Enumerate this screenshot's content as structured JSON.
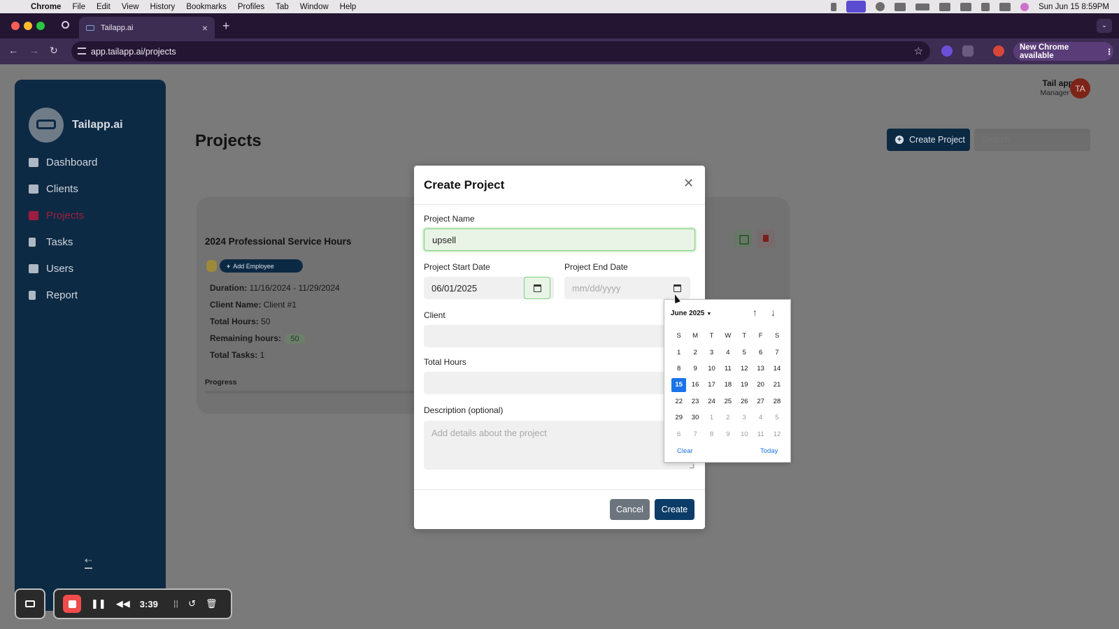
{
  "menubar": {
    "app": "Chrome",
    "items": [
      "File",
      "Edit",
      "View",
      "History",
      "Bookmarks",
      "Profiles",
      "Tab",
      "Window",
      "Help"
    ],
    "clock": "Sun Jun 15  8:59PM"
  },
  "browser": {
    "tab_title": "Tailapp.ai",
    "url": "app.tailapp.ai/projects",
    "update_button": "New Chrome available"
  },
  "sidebar": {
    "brand": "Tailapp.ai",
    "items": [
      {
        "label": "Dashboard",
        "icon": "home-icon",
        "active": false
      },
      {
        "label": "Clients",
        "icon": "users-icon",
        "active": false
      },
      {
        "label": "Projects",
        "icon": "projects-icon",
        "active": true
      },
      {
        "label": "Tasks",
        "icon": "clipboard-icon",
        "active": false
      },
      {
        "label": "Users",
        "icon": "users-icon",
        "active": false
      },
      {
        "label": "Report",
        "icon": "report-icon",
        "active": false
      }
    ]
  },
  "header": {
    "title": "Projects",
    "user_name": "Tail app",
    "user_role": "Manager",
    "avatar_initials": "TA",
    "create_button": "Create Project",
    "search_placeholder": "Search"
  },
  "project_card": {
    "title": "2024 Professional Service Hours",
    "add_employee": "Add Employee",
    "duration_label": "Duration:",
    "duration_value": "11/16/2024 - 11/29/2024",
    "client_label": "Client Name:",
    "client_value": "Client #1",
    "total_hours_label": "Total Hours:",
    "total_hours_value": "50",
    "remaining_label": "Remaining hours:",
    "remaining_value": "50",
    "total_tasks_label": "Total Tasks:",
    "total_tasks_value": "1",
    "progress_label": "Progress"
  },
  "modal": {
    "title": "Create Project",
    "project_name_label": "Project Name",
    "project_name_value": "upsell",
    "start_date_label": "Project Start Date",
    "start_date_value": "06/01/2025",
    "end_date_label": "Project End Date",
    "end_date_placeholder": "mm/dd/yyyy",
    "client_label": "Client",
    "total_hours_label": "Total Hours",
    "description_label": "Description (optional)",
    "description_placeholder": "Add details about the project",
    "cancel_button": "Cancel",
    "create_button": "Create"
  },
  "datepicker": {
    "month_label": "June 2025",
    "weekdays": [
      "S",
      "M",
      "T",
      "W",
      "T",
      "F",
      "S"
    ],
    "weeks": [
      [
        {
          "d": "1"
        },
        {
          "d": "2"
        },
        {
          "d": "3"
        },
        {
          "d": "4"
        },
        {
          "d": "5"
        },
        {
          "d": "6"
        },
        {
          "d": "7"
        }
      ],
      [
        {
          "d": "8"
        },
        {
          "d": "9"
        },
        {
          "d": "10"
        },
        {
          "d": "11"
        },
        {
          "d": "12"
        },
        {
          "d": "13"
        },
        {
          "d": "14"
        }
      ],
      [
        {
          "d": "15",
          "selected": true
        },
        {
          "d": "16"
        },
        {
          "d": "17"
        },
        {
          "d": "18"
        },
        {
          "d": "19"
        },
        {
          "d": "20"
        },
        {
          "d": "21"
        }
      ],
      [
        {
          "d": "22"
        },
        {
          "d": "23"
        },
        {
          "d": "24"
        },
        {
          "d": "25"
        },
        {
          "d": "26"
        },
        {
          "d": "27"
        },
        {
          "d": "28"
        }
      ],
      [
        {
          "d": "29"
        },
        {
          "d": "30"
        },
        {
          "d": "1",
          "muted": true
        },
        {
          "d": "2",
          "muted": true
        },
        {
          "d": "3",
          "muted": true
        },
        {
          "d": "4",
          "muted": true
        },
        {
          "d": "5",
          "muted": true
        }
      ],
      [
        {
          "d": "6",
          "muted": true
        },
        {
          "d": "7",
          "muted": true
        },
        {
          "d": "8",
          "muted": true
        },
        {
          "d": "9",
          "muted": true
        },
        {
          "d": "10",
          "muted": true
        },
        {
          "d": "11",
          "muted": true
        },
        {
          "d": "12",
          "muted": true
        }
      ]
    ],
    "clear_label": "Clear",
    "today_label": "Today"
  },
  "recorder": {
    "elapsed": "3:39"
  },
  "colors": {
    "sidebar_bg": "#0d2a44",
    "active_nav": "#9e1d3f",
    "primary_button": "#0c3c67",
    "selected_day": "#1a73e8"
  }
}
